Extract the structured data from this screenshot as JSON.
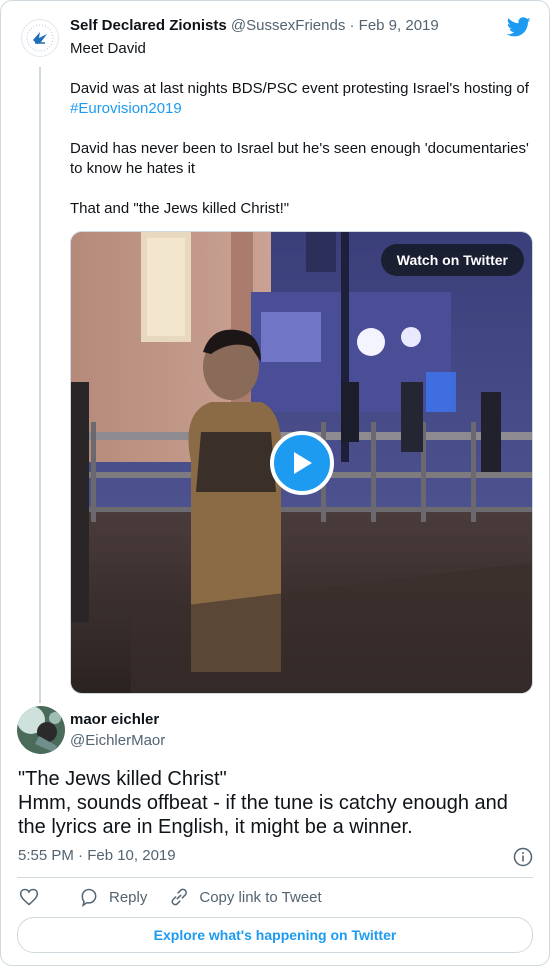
{
  "parent_tweet": {
    "author_name": "Self Declared Zionists",
    "author_handle": "@SussexFriends",
    "date": "Feb 9, 2019",
    "lines": {
      "line1": "Meet David",
      "line2": "David was at last nights BDS/PSC event protesting Israel's hosting of",
      "hashtag": "#Eurovision2019",
      "line3": "David has never been to Israel but he's seen enough 'documentaries' to know he hates it",
      "line4": "That and \"the Jews killed Christ!\""
    },
    "media": {
      "watch_label": "Watch on Twitter",
      "play_icon": "play-icon"
    }
  },
  "reply_tweet": {
    "author_name": "maor eichler",
    "author_handle": "@EichlerMaor",
    "text_line1": "\"The Jews killed Christ\"",
    "text_line2": "Hmm, sounds offbeat - if the tune is catchy enough and the lyrics are in English, it might be a winner.",
    "timestamp": "5:55 PM · Feb 10, 2019"
  },
  "actions": {
    "like_icon": "heart-icon",
    "reply_label": "Reply",
    "copy_label": "Copy link to Tweet"
  },
  "explore_label": "Explore what's happening on Twitter",
  "colors": {
    "accent": "#1d9bf0",
    "muted": "#536471",
    "border": "#cfd9de"
  }
}
